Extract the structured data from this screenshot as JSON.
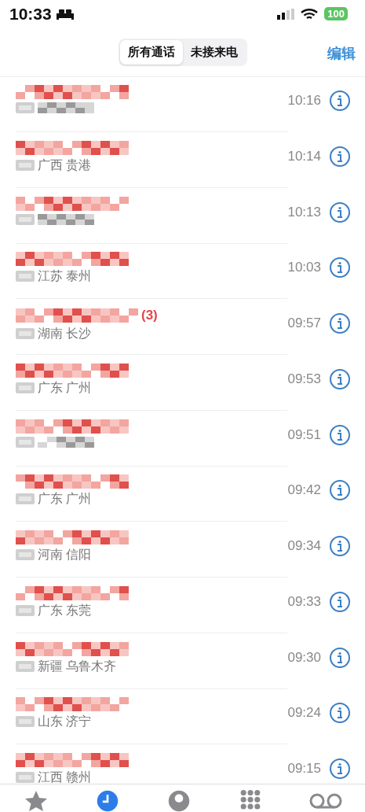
{
  "status_bar": {
    "time": "10:33",
    "battery": "100"
  },
  "nav": {
    "tabs": [
      {
        "label": "所有通话",
        "selected": true
      },
      {
        "label": "未接来电",
        "selected": false
      }
    ],
    "edit": "编辑"
  },
  "calls": [
    {
      "missed": true,
      "time": "10:16"
    },
    {
      "missed": true,
      "location": "广西 贵港",
      "time": "10:14"
    },
    {
      "missed": true,
      "time": "10:13"
    },
    {
      "missed": true,
      "location": "江苏 泰州",
      "time": "10:03"
    },
    {
      "missed": true,
      "count": "(3)",
      "location": "湖南 长沙",
      "time": "09:57"
    },
    {
      "missed": true,
      "location": "广东 广州",
      "time": "09:53"
    },
    {
      "missed": true,
      "time": "09:51"
    },
    {
      "missed": true,
      "location": "广东 广州",
      "time": "09:42"
    },
    {
      "missed": true,
      "location": "河南 信阳",
      "time": "09:34"
    },
    {
      "missed": true,
      "location": "广东 东莞",
      "time": "09:33"
    },
    {
      "missed": true,
      "location": "新疆 乌鲁木齐",
      "time": "09:30"
    },
    {
      "missed": true,
      "location": "山东 济宁",
      "time": "09:24"
    },
    {
      "missed": true,
      "location": "江西 赣州",
      "time": "09:15"
    }
  ],
  "tab_bar": [
    {
      "kind": "favorites",
      "selected": false
    },
    {
      "kind": "recents",
      "selected": true
    },
    {
      "kind": "contacts",
      "selected": false
    },
    {
      "kind": "keypad",
      "selected": false
    },
    {
      "kind": "voicemail",
      "selected": false
    }
  ]
}
